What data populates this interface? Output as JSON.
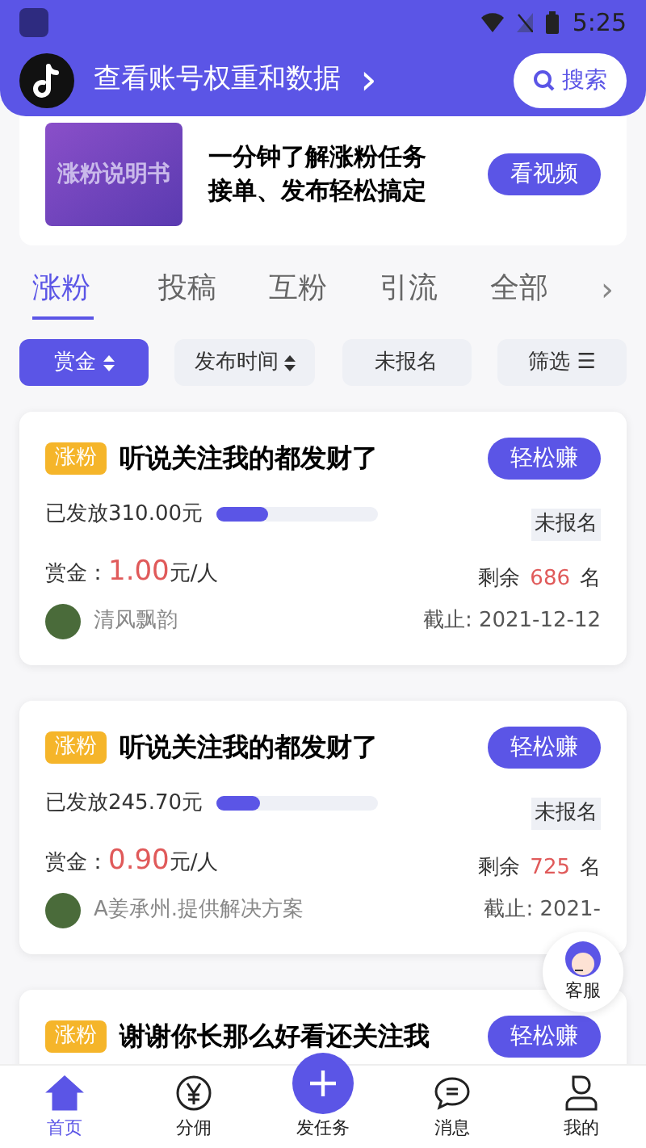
{
  "status_bar": {
    "time": "5:25"
  },
  "header": {
    "title": "查看账号权重和数据",
    "arrow": "›",
    "search": "搜索"
  },
  "banner": {
    "image_text": "涨粉说明书",
    "lines": [
      "一分钟了解涨粉任务",
      "接单、发布轻松搞定"
    ],
    "button": "看视频"
  },
  "tabs": [
    {
      "label": "涨粉",
      "selected": true
    },
    {
      "label": "投稿",
      "selected": false
    },
    {
      "label": "互粉",
      "selected": false
    },
    {
      "label": "引流",
      "selected": false
    },
    {
      "label": "全部",
      "selected": false
    }
  ],
  "tabs_more": "›",
  "filters": [
    {
      "label": "赏金",
      "sortable": true,
      "selected": true
    },
    {
      "label": "发布时间",
      "sortable": true,
      "selected": false
    },
    {
      "label": "未报名",
      "sortable": false,
      "selected": false
    },
    {
      "label": "筛选 ☰",
      "sortable": false,
      "selected": false
    }
  ],
  "tasks": [
    {
      "tag": "涨粉",
      "title": "听说关注我的都发财了",
      "button": "轻松赚",
      "paid": "已发放310.00元",
      "level": 0.32,
      "status": "未报名",
      "reward_label": "赏金：",
      "reward": "1.00",
      "reward_unit": "元/人",
      "remaining_label": "剩余",
      "remaining": "686",
      "remaining_unit": "名",
      "author": "清风飘韵",
      "deadline": "截止: 2021-12-12"
    },
    {
      "tag": "涨粉",
      "title": "听说关注我的都发财了",
      "button": "轻松赚",
      "paid": "已发放245.70元",
      "level": 0.27,
      "status": "未报名",
      "reward_label": "赏金：",
      "reward": "0.90",
      "reward_unit": "元/人",
      "remaining_label": "剩余",
      "remaining": "725",
      "remaining_unit": "名",
      "author": "A姜承州.提供解决方案",
      "deadline": "截止: 2021-"
    },
    {
      "tag": "涨粉",
      "title": "谢谢你长那么好看还关注我",
      "button": "轻松赚"
    }
  ],
  "float_service": {
    "label": "客服"
  },
  "bottom_nav": [
    {
      "label": "首页",
      "kind": "tab",
      "selected": true
    },
    {
      "label": "分佣",
      "kind": "tab",
      "selected": false
    },
    {
      "label": "发任务",
      "kind": "action",
      "selected": false
    },
    {
      "label": "消息",
      "kind": "tab",
      "selected": false
    },
    {
      "label": "我的",
      "kind": "tab",
      "selected": false
    }
  ]
}
